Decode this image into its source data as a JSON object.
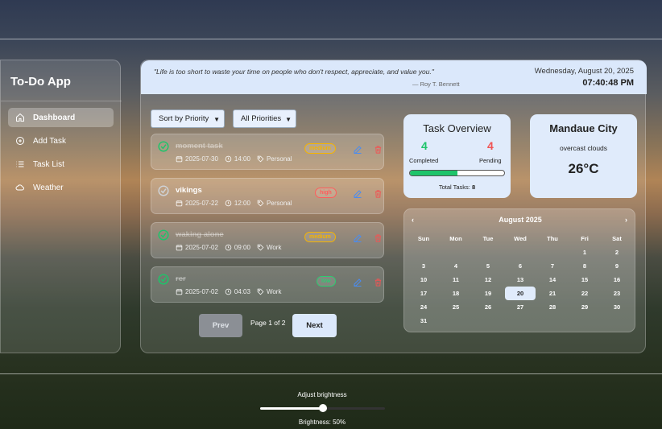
{
  "app": {
    "title": "To-Do App"
  },
  "sidebar": {
    "items": [
      {
        "label": "Dashboard",
        "icon": "home-icon",
        "active": true
      },
      {
        "label": "Add Task",
        "icon": "plus-circle-icon",
        "active": false
      },
      {
        "label": "Task List",
        "icon": "list-icon",
        "active": false
      },
      {
        "label": "Weather",
        "icon": "cloud-icon",
        "active": false
      }
    ]
  },
  "header": {
    "quote": "\"Life is too short to waste your time on people who don't respect, appreciate, and value you.\"",
    "author": "— Roy T. Bennett",
    "date": "Wednesday, August 20, 2025",
    "time": "07:40:48 PM"
  },
  "filters": {
    "sort": "Sort by Priority",
    "priority": "All Priorities"
  },
  "tasks": [
    {
      "name": "moment task",
      "completed": true,
      "date": "2025-07-30",
      "time": "14:00",
      "category": "Personal",
      "priority": "medium"
    },
    {
      "name": "vikings",
      "completed": false,
      "date": "2025-07-22",
      "time": "12:00",
      "category": "Personal",
      "priority": "high"
    },
    {
      "name": "waking alone",
      "completed": true,
      "date": "2025-07-02",
      "time": "09:00",
      "category": "Work",
      "priority": "medium"
    },
    {
      "name": "rer",
      "completed": true,
      "date": "2025-07-02",
      "time": "04:03",
      "category": "Work",
      "priority": "low"
    }
  ],
  "pagination": {
    "prev": "Prev",
    "info": "Page 1 of 2",
    "next": "Next"
  },
  "overview": {
    "title": "Task Overview",
    "completed": "4",
    "completed_label": "Completed",
    "pending": "4",
    "pending_label": "Pending",
    "progress_fraction": 0.5,
    "total_label": "Total Tasks:",
    "total": "8"
  },
  "weather": {
    "city": "Mandaue City",
    "description": "overcast clouds",
    "temp": "26°C"
  },
  "calendar": {
    "prev": "‹",
    "month": "August 2025",
    "next": "›",
    "days_of_week": [
      "Sun",
      "Mon",
      "Tue",
      "Wed",
      "Thu",
      "Fri",
      "Sat"
    ],
    "leading_blanks": 5,
    "days_in_month": 31,
    "today": 20
  },
  "brightness": {
    "label": "Adjust brightness",
    "value_label": "Brightness: 50%",
    "fraction": 0.5
  },
  "colors": {
    "completed": "#1ec46a",
    "pending": "#f05454",
    "medium": "#f5b400",
    "high": "#ff5c5c",
    "low": "#2ecc71",
    "card": "#e0ebfb"
  }
}
